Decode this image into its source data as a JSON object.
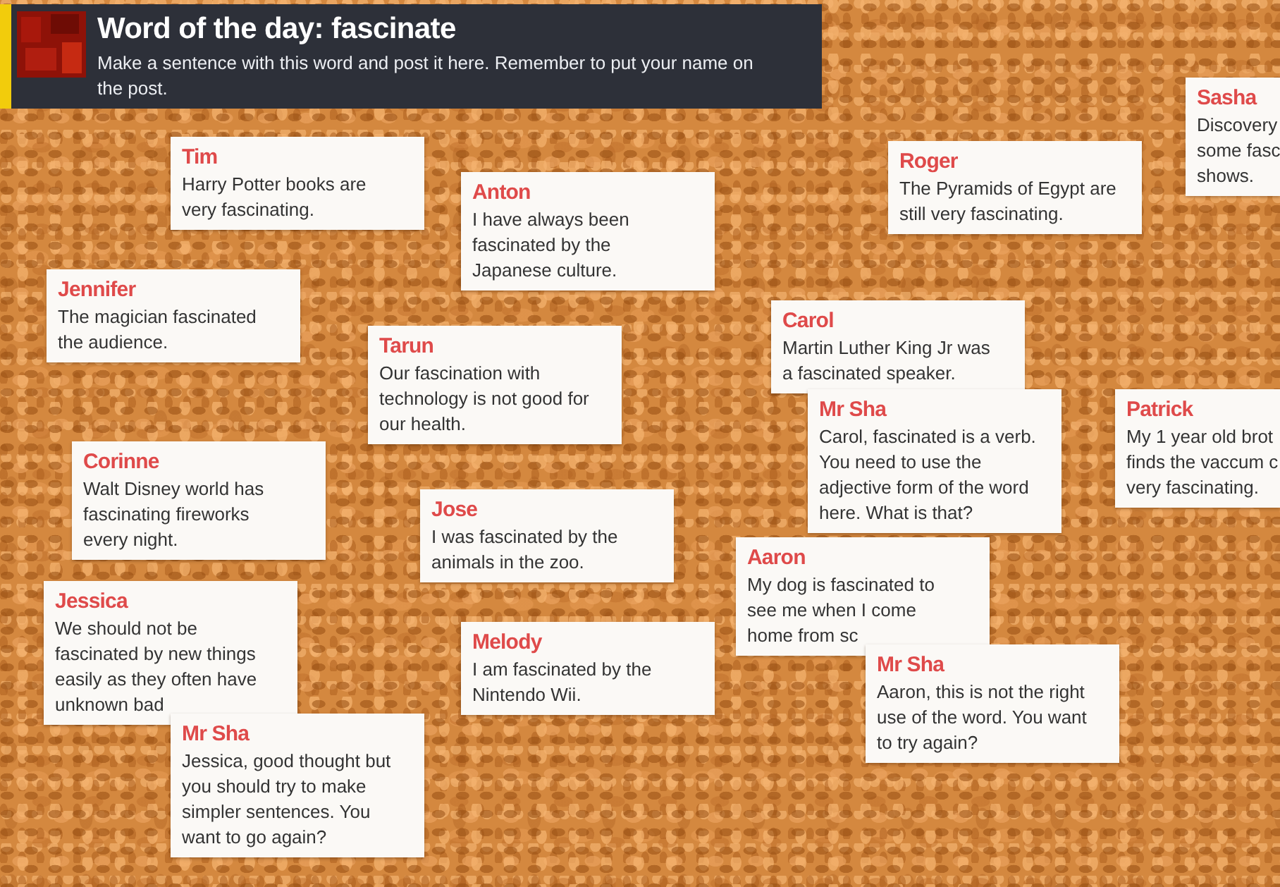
{
  "header": {
    "title": "Word of the day: fascinate",
    "description": "Make a sentence with this word and post it here. Remember to put your name on\nthe post."
  },
  "notes": [
    {
      "author": "Jennifer",
      "text": "The magician fascinated\nthe audience."
    },
    {
      "author": "Corinne",
      "text": "Walt Disney world has\nfascinating fireworks\nevery night."
    },
    {
      "author": "Jessica",
      "text": "We should not be\nfascinated by new things\neasily as they often have\nunknown bad"
    },
    {
      "author": "Tim",
      "text": "Harry Potter books are\nvery fascinating."
    },
    {
      "author": "Mr Sha",
      "text": "Jessica, good thought but\nyou should try to make\nsimpler sentences. You\nwant to go again?"
    },
    {
      "author": "Anton",
      "text": "I have always been\nfascinated by the\nJapanese culture."
    },
    {
      "author": "Tarun",
      "text": "Our fascination with\ntechnology is not good for\nour health."
    },
    {
      "author": "Jose",
      "text": "I was fascinated by the\nanimals in the zoo."
    },
    {
      "author": "Melody",
      "text": "I am fascinated by the\nNintendo Wii."
    },
    {
      "author": "Roger",
      "text": "The Pyramids of Egypt are\nstill very fascinating."
    },
    {
      "author": "Carol",
      "text": "Martin Luther King Jr was\na fascinated speaker."
    },
    {
      "author": "Mr Sha",
      "text": "Carol, fascinated is a verb.\nYou need to use the\nadjective form of the word\nhere. What is that?"
    },
    {
      "author": "Aaron",
      "text": "My dog is fascinated to\nsee me when I come\nhome from sc"
    },
    {
      "author": "Mr Sha",
      "text": "Aaron, this is not the right\nuse of the word. You want\nto try again?"
    },
    {
      "author": "Sasha",
      "text": "Discovery\nsome fasc\nshows."
    },
    {
      "author": "Patrick",
      "text": "My 1 year old brot\nfinds the vaccum c\nvery fascinating."
    }
  ]
}
